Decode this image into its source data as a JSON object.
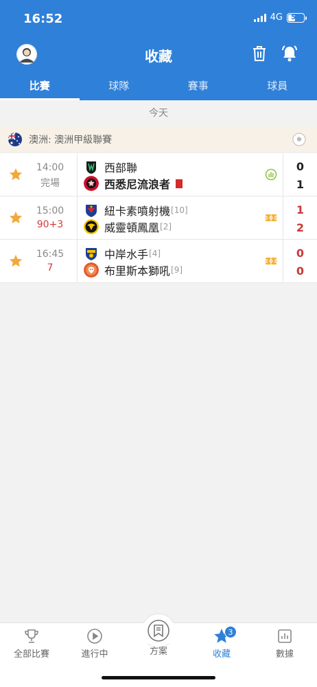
{
  "status_bar": {
    "time": "16:52",
    "network": "4G",
    "battery": "51",
    "battery_level": 0.51
  },
  "header": {
    "title": "收藏"
  },
  "tabs": [
    {
      "label": "比賽",
      "active": true
    },
    {
      "label": "球隊",
      "active": false
    },
    {
      "label": "賽事",
      "active": false
    },
    {
      "label": "球員",
      "active": false
    }
  ],
  "date_label": "今天",
  "league": {
    "name": "澳洲: 澳洲甲級聯賽"
  },
  "matches": [
    {
      "time": "14:00",
      "status": "完場",
      "status_live": false,
      "home": {
        "name": "西部聯",
        "rank": "",
        "bold": false,
        "score": "0"
      },
      "away": {
        "name": "西悉尼流浪者",
        "rank": "",
        "bold": true,
        "score": "1",
        "red_card": true
      },
      "icon": "stats-icon"
    },
    {
      "time": "15:00",
      "status": "90+3",
      "status_live": true,
      "home": {
        "name": "紐卡素噴射機",
        "rank": "[10]",
        "bold": false,
        "score": "1"
      },
      "away": {
        "name": "威靈頓鳳凰",
        "rank": "[2]",
        "bold": false,
        "score": "2"
      },
      "icon": "live-field-icon"
    },
    {
      "time": "16:45",
      "status": "7",
      "status_live": true,
      "home": {
        "name": "中岸水手",
        "rank": "[4]",
        "bold": false,
        "score": "0"
      },
      "away": {
        "name": "布里斯本獅吼",
        "rank": "[9]",
        "bold": false,
        "score": "0"
      },
      "icon": "live-field-icon"
    }
  ],
  "bottom_nav": [
    {
      "label": "全部比賽",
      "icon": "trophy-icon"
    },
    {
      "label": "進行中",
      "icon": "play-circle-icon"
    },
    {
      "label": "方案",
      "icon": "bookmark-icon"
    },
    {
      "label": "收藏",
      "icon": "star-icon",
      "active": true,
      "badge": "3"
    },
    {
      "label": "數據",
      "icon": "bar-chart-icon"
    }
  ],
  "colors": {
    "brand": "#2f80d8",
    "star": "#f2a93b",
    "live": "#d43838",
    "league_bg": "#f7f1e8"
  }
}
